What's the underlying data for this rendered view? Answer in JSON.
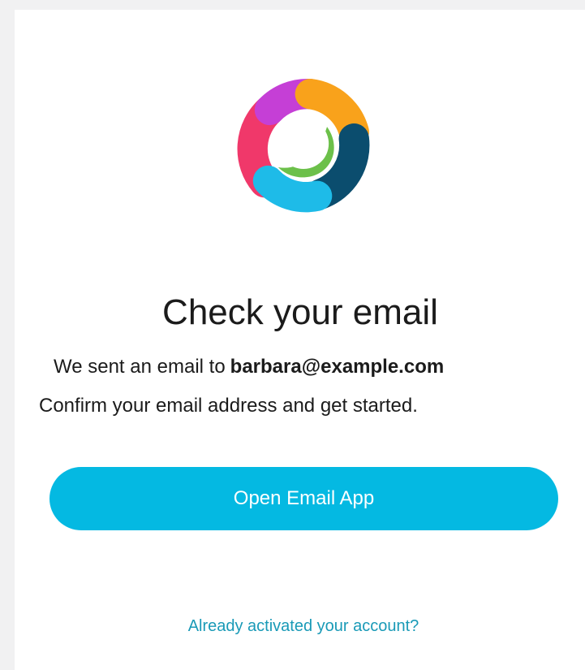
{
  "logo": {
    "icon": "webex-logo-icon",
    "colors": [
      "#c53fd6",
      "#f9a21b",
      "#6cc04a",
      "#0b4d6e",
      "#1ebbe8",
      "#f0386a"
    ]
  },
  "content": {
    "title": "Check your email",
    "sent_prefix": "We sent an email to",
    "email": "barbara@example.com",
    "instruction": "Confirm your email address and get started."
  },
  "actions": {
    "open_email_label": "Open Email App",
    "already_activated_label": "Already activated your account?"
  },
  "colors": {
    "accent": "#04b9e2",
    "link": "#1a9ab7",
    "text": "#1b1b1b"
  }
}
